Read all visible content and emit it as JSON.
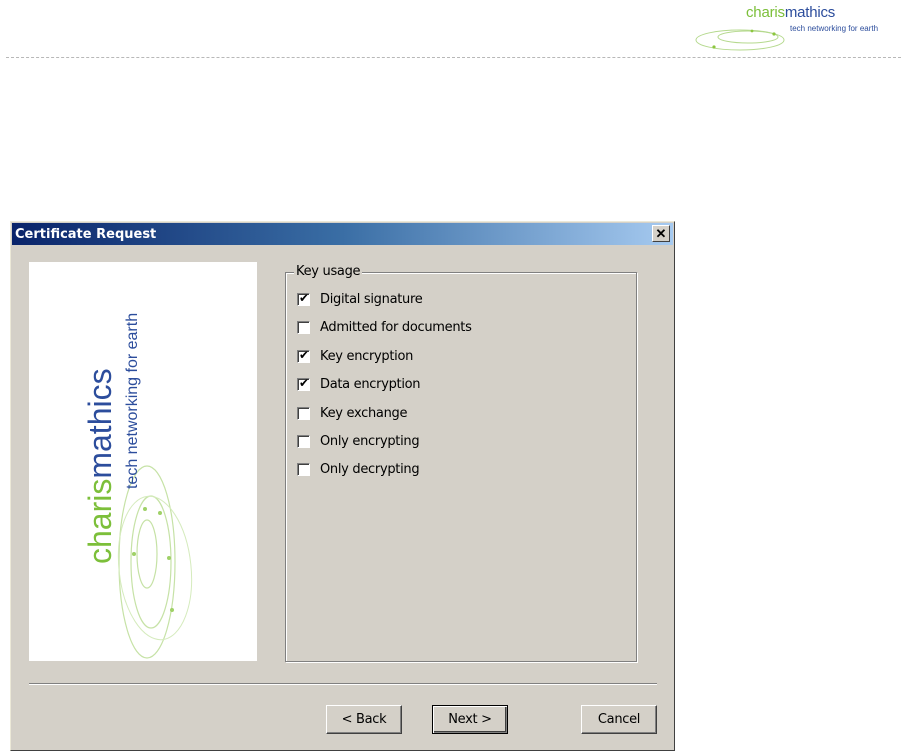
{
  "page_header": {
    "logo": {
      "word_part1": "charis",
      "word_part2": "mathics",
      "tagline": "tech networking for earth",
      "color_green": "#7cbf3a",
      "color_blue": "#2c4d9c"
    }
  },
  "dialog": {
    "title": "Certificate Request",
    "close_label": "✕",
    "side_logo": {
      "word_part1": "charis",
      "word_part2": "mathics",
      "tagline": "tech networking for earth"
    },
    "key_usage": {
      "legend": "Key usage",
      "options": [
        {
          "label": "Digital signature",
          "checked": true
        },
        {
          "label": "Admitted for documents",
          "checked": false
        },
        {
          "label": "Key encryption",
          "checked": true
        },
        {
          "label": "Data encryption",
          "checked": true
        },
        {
          "label": "Key exchange",
          "checked": false
        },
        {
          "label": "Only encrypting",
          "checked": false
        },
        {
          "label": "Only decrypting",
          "checked": false
        }
      ]
    },
    "buttons": {
      "back": "< Back",
      "next": "Next >",
      "cancel": "Cancel"
    },
    "colors": {
      "title_bar_start": "#0a246a",
      "title_bar_end": "#a6caf0",
      "face": "#d4d0c8"
    }
  }
}
